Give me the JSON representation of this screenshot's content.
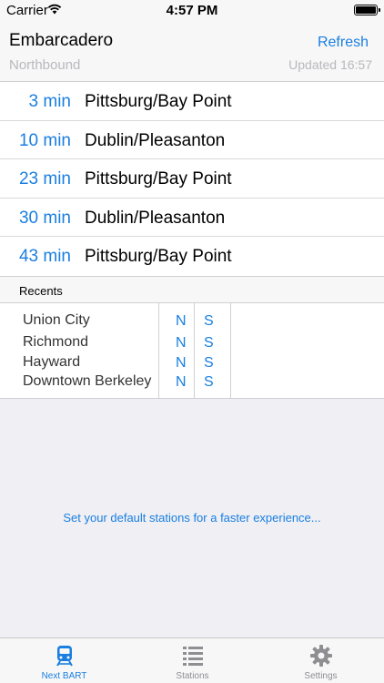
{
  "status_bar": {
    "carrier": "Carrier",
    "time": "4:57 PM"
  },
  "header": {
    "station": "Embarcadero",
    "direction": "Northbound",
    "refresh_label": "Refresh",
    "updated": "Updated 16:57"
  },
  "departures": [
    {
      "mins": "3 min",
      "destination": "Pittsburg/Bay Point"
    },
    {
      "mins": "10 min",
      "destination": "Dublin/Pleasanton"
    },
    {
      "mins": "23 min",
      "destination": "Pittsburg/Bay Point"
    },
    {
      "mins": "30 min",
      "destination": "Dublin/Pleasanton"
    },
    {
      "mins": "43 min",
      "destination": "Pittsburg/Bay Point"
    }
  ],
  "recents": {
    "header": "Recents",
    "items": [
      {
        "name": "Union City",
        "north": "N",
        "south": "S"
      },
      {
        "name": "Richmond",
        "north": "N",
        "south": "S"
      },
      {
        "name": "Hayward",
        "north": "N",
        "south": "S"
      },
      {
        "name": "Downtown Berkeley",
        "north": "N",
        "south": "S"
      }
    ]
  },
  "hint": "Set your default stations for a faster experience...",
  "tabs": [
    {
      "label": "Next BART",
      "icon": "train-icon",
      "active": true
    },
    {
      "label": "Stations",
      "icon": "list-icon",
      "active": false
    },
    {
      "label": "Settings",
      "icon": "gear-icon",
      "active": false
    }
  ],
  "colors": {
    "accent": "#1a7fe0",
    "muted": "#b9b9be",
    "background": "#efeff4"
  }
}
